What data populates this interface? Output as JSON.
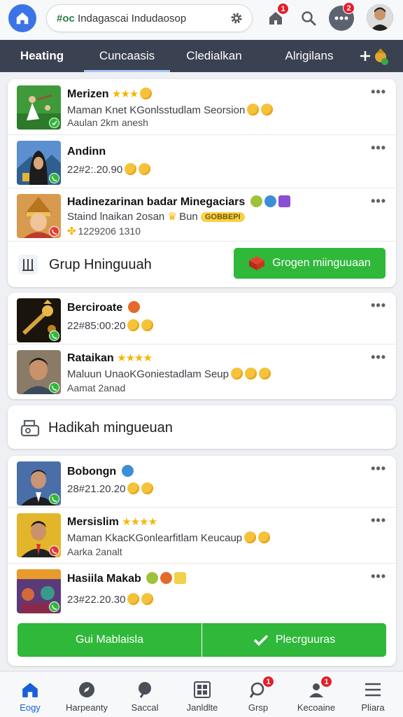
{
  "header": {
    "search_prefix": "#oc",
    "search_text": "Indagascai Indudaosop",
    "badge_notifications": "1",
    "badge_messages": "2"
  },
  "tabs": [
    {
      "label": "Heating",
      "active": false
    },
    {
      "label": "Cuncaasis",
      "active": true
    },
    {
      "label": "Cledialkan",
      "active": false
    },
    {
      "label": "Alrigilans",
      "active": false
    }
  ],
  "group1": {
    "items": [
      {
        "title": "Merizen",
        "sub": "Maman Knet KGonlsstudlam Seorsion",
        "meta": "Aaulan 2km anesh"
      },
      {
        "title": "Andinn",
        "sub": "22#2:.20.90"
      },
      {
        "title": "Hadinezarinan badar Minegaciars",
        "sub": "Staind lnaikan 2osan",
        "sub_tag": "Bun",
        "sub_pill": "GOBBEPI",
        "meta": "1229206 1310"
      }
    ],
    "footer_label": "Grup Hninguuah",
    "footer_button": "Grogen miinguuaan"
  },
  "group2": {
    "items": [
      {
        "title": "Berciroate",
        "sub": "22#85:00:20"
      },
      {
        "title": "Rataikan",
        "sub": "Maluun UnaoKGoniestadlam Seup",
        "meta": "Aamat 2anad"
      }
    ]
  },
  "section_label": "Hadikah mingueuan",
  "group3": {
    "items": [
      {
        "title": "Bobongn",
        "sub": "28#21.20.20"
      },
      {
        "title": "Mersislim",
        "sub": "Maman KkacKGonlearfitlam Keucaup",
        "meta": "Aarka 2analt"
      },
      {
        "title": "Hasiila Makab",
        "sub": "23#22.20.30"
      }
    ],
    "button_left": "Gui Mablaisla",
    "button_right": "Plecrguuras"
  },
  "bottom_nav": [
    {
      "label": "Eogy",
      "icon": "home-icon",
      "active": true
    },
    {
      "label": "Harpeanty",
      "icon": "compass-icon",
      "active": false
    },
    {
      "label": "Saccal",
      "icon": "search-icon",
      "active": false
    },
    {
      "label": "Janldlte",
      "icon": "grid-icon",
      "active": false
    },
    {
      "label": "Grsp",
      "icon": "chat-search-icon",
      "active": false,
      "badge": "1"
    },
    {
      "label": "Kecoaine",
      "icon": "person-icon",
      "active": false,
      "badge": "1"
    },
    {
      "label": "Pliara",
      "icon": "menu-icon",
      "active": false
    }
  ],
  "colors": {
    "accent": "#3b74e6",
    "tabbar": "#3a4150",
    "green": "#2fb83a",
    "badge": "#e41e2b"
  }
}
